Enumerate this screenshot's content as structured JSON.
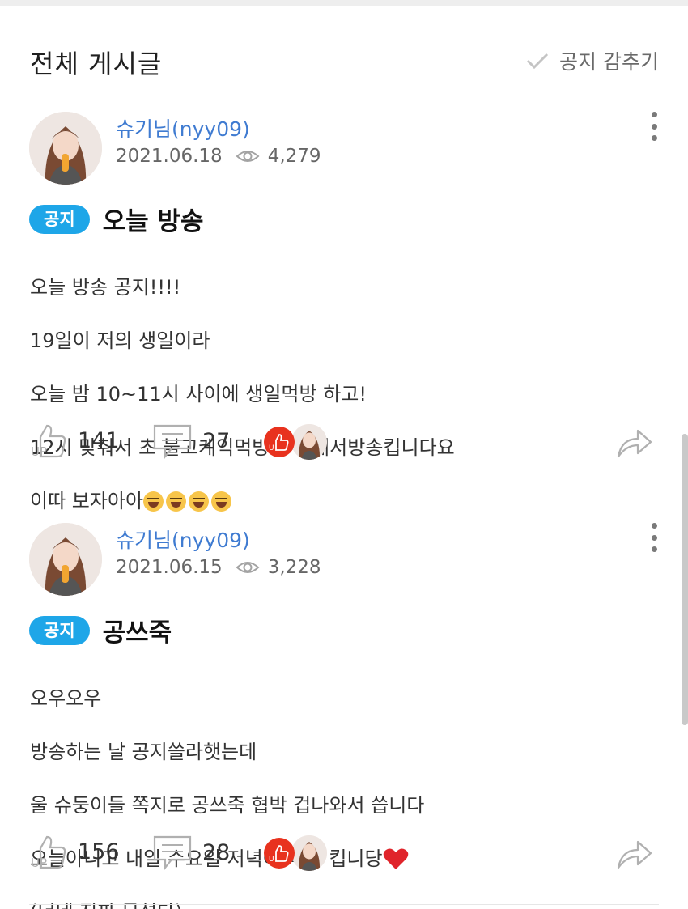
{
  "header": {
    "title": "전체 게시글",
    "hide_notice_label": "공지 감추기"
  },
  "posts": [
    {
      "author": "슈기님(nyy09)",
      "date": "2021.06.18",
      "views": "4,279",
      "badge": "공지",
      "title": "오늘 방송",
      "body_lines": [
        "오늘 방송 공지!!!!",
        "19일이 저의 생일이라",
        "오늘 밤 10~11시 사이에 생일먹방 하고!",
        "12시 맞춰서 초 불고케익먹방까지 해서방송킵니다요",
        "이따 보자아아"
      ],
      "body_emoji_count": 4,
      "likes": "141",
      "comments": "27"
    },
    {
      "author": "슈기님(nyy09)",
      "date": "2021.06.15",
      "views": "3,228",
      "badge": "공지",
      "title": "공쓰죽",
      "body_lines": [
        "오우오우",
        "방송하는 날 공지쓸라햇는데",
        "울 슈둥이들 쪽지로 공쓰죽 협박 겁나와서 씁니다",
        "오늘아니고 내일 수요일 저녁에 먹방 킵니당",
        "(너네 진짜 무섭다)"
      ],
      "body_emoji": "red-heart",
      "likes": "156",
      "comments": "28"
    }
  ],
  "icons": [
    "check-icon",
    "eye-icon",
    "more-vertical-icon",
    "thumbs-up-icon",
    "comment-icon",
    "share-arrow-icon",
    "laughing-emoji-icon",
    "heart-emoji-icon"
  ],
  "colors": {
    "author": "#3f7bd1",
    "badge": "#1ea6e8",
    "liker_badge": "#e8321e",
    "heart": "#e0242b"
  }
}
